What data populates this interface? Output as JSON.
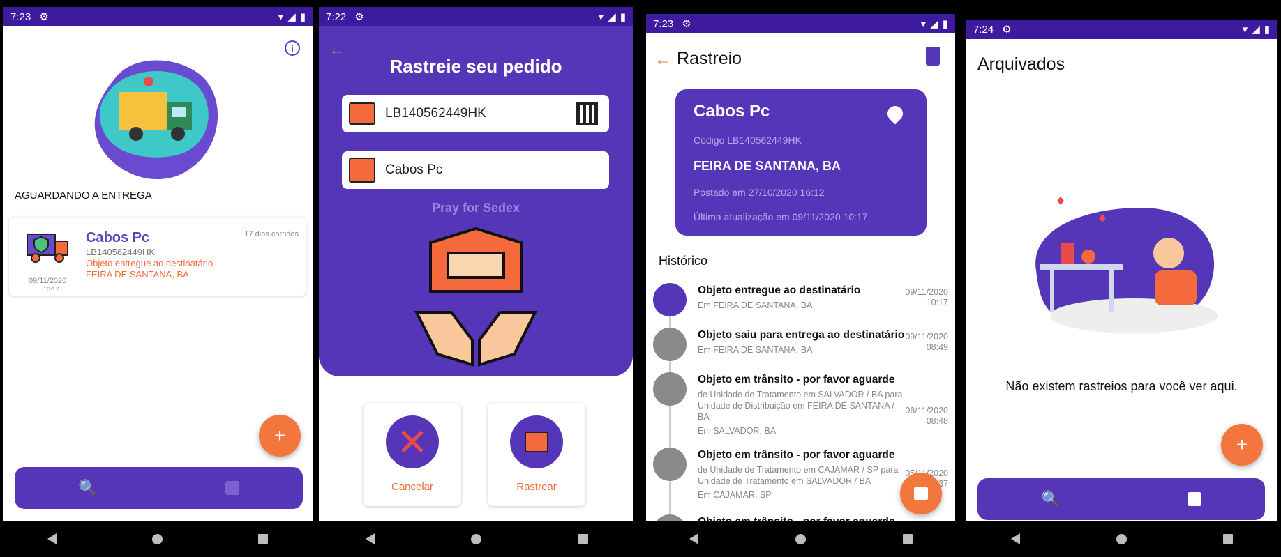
{
  "status_bars": [
    {
      "time": "7:23"
    },
    {
      "time": "7:22"
    },
    {
      "time": "7:23"
    },
    {
      "time": "7:24"
    }
  ],
  "home": {
    "section_title": "AGUARDANDO A ENTREGA",
    "card": {
      "name": "Cabos Pc",
      "days": "17 dias corridos",
      "code": "LB140562449HK",
      "status": "Objeto entregue ao destinatário",
      "city": "FEIRA DE SANTANA, BA",
      "date": "09/11/2020",
      "time": "10:17"
    },
    "fab_label": "+"
  },
  "track_form": {
    "title": "Rastreie seu pedido",
    "code_value": "LB140562449HK",
    "name_value": "Cabos Pc",
    "tagline": "Pray for Sedex",
    "cancel_label": "Cancelar",
    "track_label": "Rastrear"
  },
  "detail": {
    "title": "Rastreio",
    "card": {
      "name": "Cabos Pc",
      "code": "Código LB140562449HK",
      "city": "FEIRA DE SANTANA, BA",
      "posted": "Postado em 27/10/2020 16:12",
      "updated": "Última atualização em 09/11/2020 10:17"
    },
    "history_title": "Histórico",
    "history": [
      {
        "title": "Objeto entregue ao destinatário",
        "sub": "Em FEIRA DE SANTANA, BA",
        "date": "09/11/2020",
        "time": "10:17"
      },
      {
        "title": "Objeto saiu para entrega ao destinatário",
        "sub": "Em FEIRA DE SANTANA, BA",
        "date": "09/11/2020",
        "time": "08:49"
      },
      {
        "title": "Objeto em trânsito - por favor aguarde",
        "sub": "de Unidade de Tratamento em SALVADOR / BA para Unidade de Distribuição em FEIRA DE SANTANA / BA",
        "sub2": "Em SALVADOR, BA",
        "date": "06/11/2020",
        "time": "08:48"
      },
      {
        "title": "Objeto em trânsito - por favor aguarde",
        "sub": "de Unidade de Tratamento em CAJAMAR / SP para Unidade de Tratamento em SALVADOR / BA",
        "sub2": "Em CAJAMAR, SP",
        "date": "05/11/2020",
        "time": "00:37"
      },
      {
        "title": "Objeto em trânsito - por favor aguarde"
      }
    ]
  },
  "archive": {
    "title": "Arquivados",
    "empty_message": "Não existem rastreios para você ver aqui.",
    "fab_label": "+"
  },
  "colors": {
    "brand_purple": "#5535b8",
    "status_bar": "#3d1a9e",
    "accent_orange": "#f4763f"
  }
}
